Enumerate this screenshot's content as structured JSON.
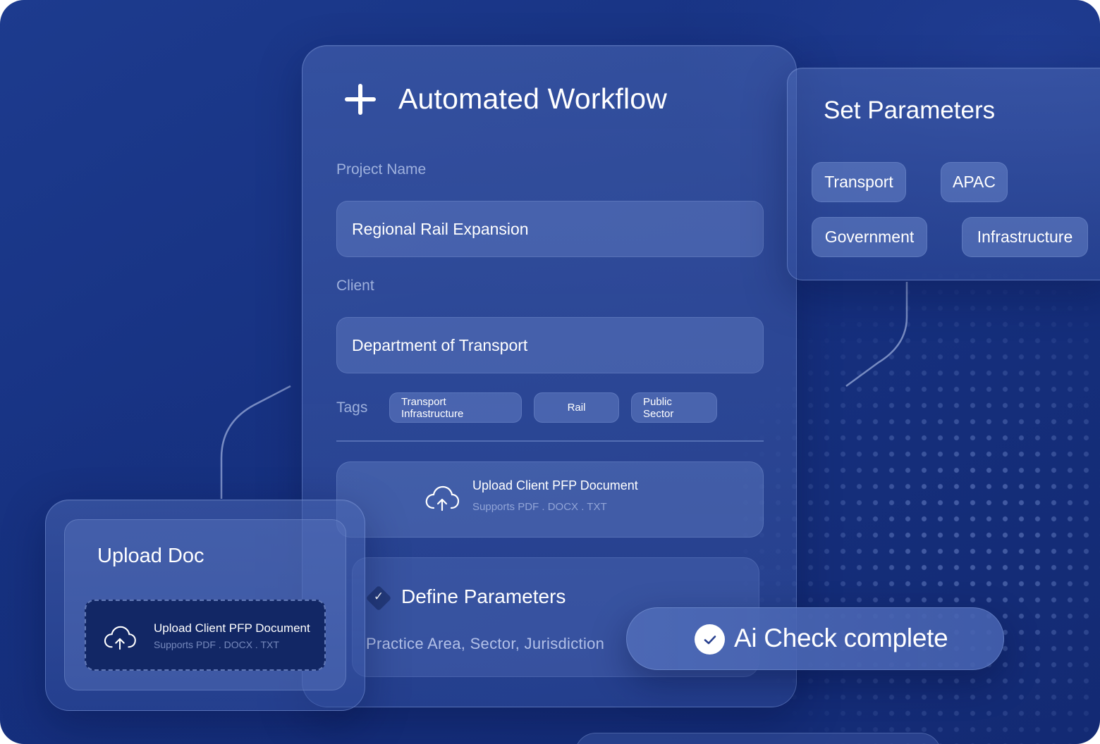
{
  "workflow": {
    "title": "Automated Workflow",
    "project_label": "Project Name",
    "project_value": "Regional Rail Expansion",
    "client_label": "Client",
    "client_value": "Department of Transport",
    "tags_label": "Tags",
    "tags": [
      "Transport Infrastructure",
      "Rail",
      "Public Sector"
    ],
    "upload": {
      "title": "Upload Client PFP Document",
      "subtitle": "Supports PDF .  DOCX . TXT"
    },
    "define": {
      "title": "Define Parameters",
      "subtitle": "Practice Area, Sector, Jurisdiction"
    }
  },
  "parameters": {
    "title": "Set Parameters",
    "chips": [
      "Transport",
      "APAC",
      "Government",
      "Infrastructure"
    ]
  },
  "upload_doc": {
    "title": "Upload Doc",
    "drop_title": "Upload Client PFP Document",
    "drop_subtitle": "Supports PDF .  DOCX . TXT"
  },
  "ai_status": {
    "text": "Ai Check complete"
  },
  "icons": {
    "add": "plus-icon",
    "upload": "cloud-upload-icon",
    "check": "check-icon"
  },
  "colors": {
    "background": "#173282",
    "panel": "#4a66b2",
    "drop_zone": "#122765",
    "text": "#ffffff"
  }
}
